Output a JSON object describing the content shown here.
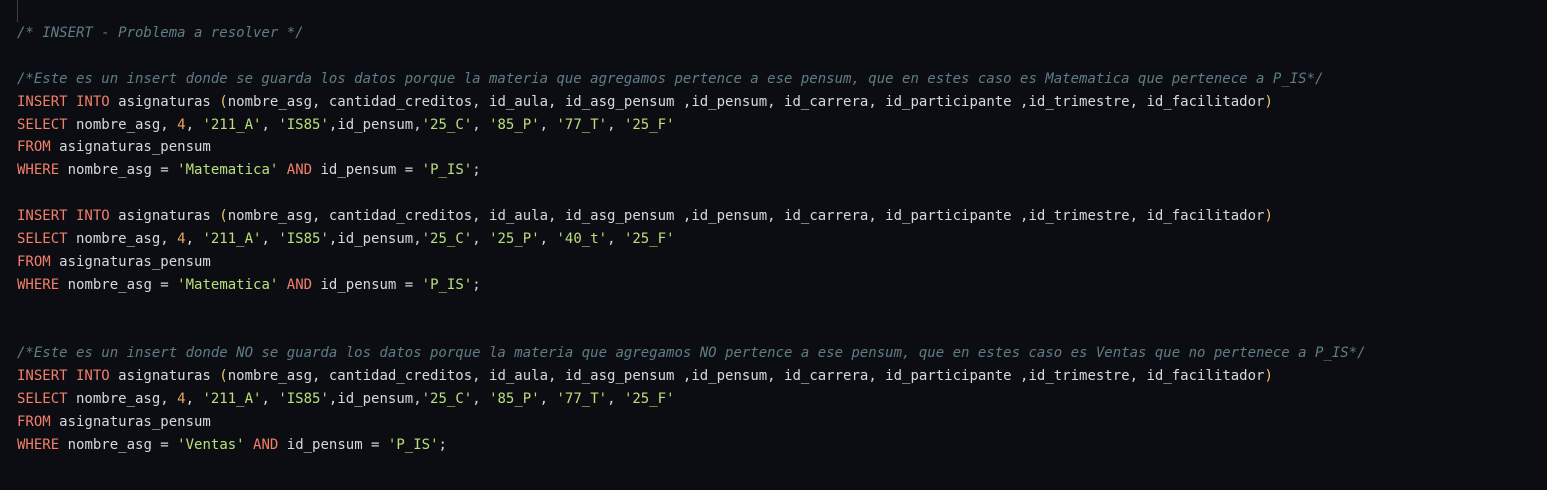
{
  "editor": {
    "lines": [
      [
        {
          "t": "/* INSERT - Problema a resolver */",
          "c": "comment"
        }
      ],
      [],
      [
        {
          "t": "/*Este es un insert donde se guarda los datos porque la materia que agregamos pertence a ese pensum, que en estes caso es Matematica que pertenece a P_IS*/",
          "c": "comment"
        }
      ],
      [
        {
          "t": "INSERT INTO",
          "c": "kw"
        },
        {
          "t": " asignaturas ",
          "c": "plain"
        },
        {
          "t": "(",
          "c": "punc"
        },
        {
          "t": "nombre_asg, cantidad_creditos, id_aula, id_asg_pensum ,id_pensum, id_carrera, id_participante ,id_trimestre, id_facilitador",
          "c": "plain"
        },
        {
          "t": ")",
          "c": "punc"
        }
      ],
      [
        {
          "t": "SELECT",
          "c": "kw"
        },
        {
          "t": " nombre_asg, ",
          "c": "plain"
        },
        {
          "t": "4",
          "c": "num"
        },
        {
          "t": ", ",
          "c": "plain"
        },
        {
          "t": "'211_A'",
          "c": "str"
        },
        {
          "t": ", ",
          "c": "plain"
        },
        {
          "t": "'IS85'",
          "c": "str"
        },
        {
          "t": ",id_pensum,",
          "c": "plain"
        },
        {
          "t": "'25_C'",
          "c": "str"
        },
        {
          "t": ", ",
          "c": "plain"
        },
        {
          "t": "'85_P'",
          "c": "str"
        },
        {
          "t": ", ",
          "c": "plain"
        },
        {
          "t": "'77_T'",
          "c": "str"
        },
        {
          "t": ", ",
          "c": "plain"
        },
        {
          "t": "'25_F'",
          "c": "str"
        }
      ],
      [
        {
          "t": "FROM",
          "c": "kw"
        },
        {
          "t": " asignaturas_pensum",
          "c": "plain"
        }
      ],
      [
        {
          "t": "WHERE",
          "c": "kw"
        },
        {
          "t": " nombre_asg = ",
          "c": "plain"
        },
        {
          "t": "'Matematica'",
          "c": "str"
        },
        {
          "t": " ",
          "c": "plain"
        },
        {
          "t": "AND",
          "c": "kw"
        },
        {
          "t": " id_pensum = ",
          "c": "plain"
        },
        {
          "t": "'P_IS'",
          "c": "str"
        },
        {
          "t": ";",
          "c": "plain"
        }
      ],
      [],
      [
        {
          "t": "INSERT INTO",
          "c": "kw"
        },
        {
          "t": " asignaturas ",
          "c": "plain"
        },
        {
          "t": "(",
          "c": "punc"
        },
        {
          "t": "nombre_asg, cantidad_creditos, id_aula, id_asg_pensum ,id_pensum, id_carrera, id_participante ,id_trimestre, id_facilitador",
          "c": "plain"
        },
        {
          "t": ")",
          "c": "punc"
        }
      ],
      [
        {
          "t": "SELECT",
          "c": "kw"
        },
        {
          "t": " nombre_asg, ",
          "c": "plain"
        },
        {
          "t": "4",
          "c": "num"
        },
        {
          "t": ", ",
          "c": "plain"
        },
        {
          "t": "'211_A'",
          "c": "str"
        },
        {
          "t": ", ",
          "c": "plain"
        },
        {
          "t": "'IS85'",
          "c": "str"
        },
        {
          "t": ",id_pensum,",
          "c": "plain"
        },
        {
          "t": "'25_C'",
          "c": "str"
        },
        {
          "t": ", ",
          "c": "plain"
        },
        {
          "t": "'25_P'",
          "c": "str"
        },
        {
          "t": ", ",
          "c": "plain"
        },
        {
          "t": "'40_t'",
          "c": "str"
        },
        {
          "t": ", ",
          "c": "plain"
        },
        {
          "t": "'25_F'",
          "c": "str"
        }
      ],
      [
        {
          "t": "FROM",
          "c": "kw"
        },
        {
          "t": " asignaturas_pensum",
          "c": "plain"
        }
      ],
      [
        {
          "t": "WHERE",
          "c": "kw"
        },
        {
          "t": " nombre_asg = ",
          "c": "plain"
        },
        {
          "t": "'Matematica'",
          "c": "str"
        },
        {
          "t": " ",
          "c": "plain"
        },
        {
          "t": "AND",
          "c": "kw"
        },
        {
          "t": " id_pensum = ",
          "c": "plain"
        },
        {
          "t": "'P_IS'",
          "c": "str"
        },
        {
          "t": ";",
          "c": "plain"
        }
      ],
      [],
      [],
      [
        {
          "t": "/*Este es un insert donde NO se guarda los datos porque la materia que agregamos NO pertence a ese pensum, que en estes caso es Ventas que no pertenece a P_IS*/",
          "c": "comment"
        }
      ],
      [
        {
          "t": "INSERT INTO",
          "c": "kw"
        },
        {
          "t": " asignaturas ",
          "c": "plain"
        },
        {
          "t": "(",
          "c": "punc"
        },
        {
          "t": "nombre_asg, cantidad_creditos, id_aula, id_asg_pensum ,id_pensum, id_carrera, id_participante ,id_trimestre, id_facilitador",
          "c": "plain"
        },
        {
          "t": ")",
          "c": "punc"
        }
      ],
      [
        {
          "t": "SELECT",
          "c": "kw"
        },
        {
          "t": " nombre_asg, ",
          "c": "plain"
        },
        {
          "t": "4",
          "c": "num"
        },
        {
          "t": ", ",
          "c": "plain"
        },
        {
          "t": "'211_A'",
          "c": "str"
        },
        {
          "t": ", ",
          "c": "plain"
        },
        {
          "t": "'IS85'",
          "c": "str"
        },
        {
          "t": ",id_pensum,",
          "c": "plain"
        },
        {
          "t": "'25_C'",
          "c": "str"
        },
        {
          "t": ", ",
          "c": "plain"
        },
        {
          "t": "'85_P'",
          "c": "str"
        },
        {
          "t": ", ",
          "c": "plain"
        },
        {
          "t": "'77_T'",
          "c": "str"
        },
        {
          "t": ", ",
          "c": "plain"
        },
        {
          "t": "'25_F'",
          "c": "str"
        }
      ],
      [
        {
          "t": "FROM",
          "c": "kw"
        },
        {
          "t": " asignaturas_pensum",
          "c": "plain"
        }
      ],
      [
        {
          "t": "WHERE",
          "c": "kw"
        },
        {
          "t": " nombre_asg = ",
          "c": "plain"
        },
        {
          "t": "'Ventas'",
          "c": "str"
        },
        {
          "t": " ",
          "c": "plain"
        },
        {
          "t": "AND",
          "c": "kw"
        },
        {
          "t": " id_pensum = ",
          "c": "plain"
        },
        {
          "t": "'P_IS'",
          "c": "str"
        },
        {
          "t": ";",
          "c": "plain"
        }
      ]
    ]
  },
  "colors": {
    "background": "#0b0d13",
    "comment": "#5f7d86",
    "keyword": "#f27f69",
    "string": "#b9e07a",
    "number": "#f0a35d",
    "paren": "#f0c674",
    "plain": "#d6d8dc"
  }
}
